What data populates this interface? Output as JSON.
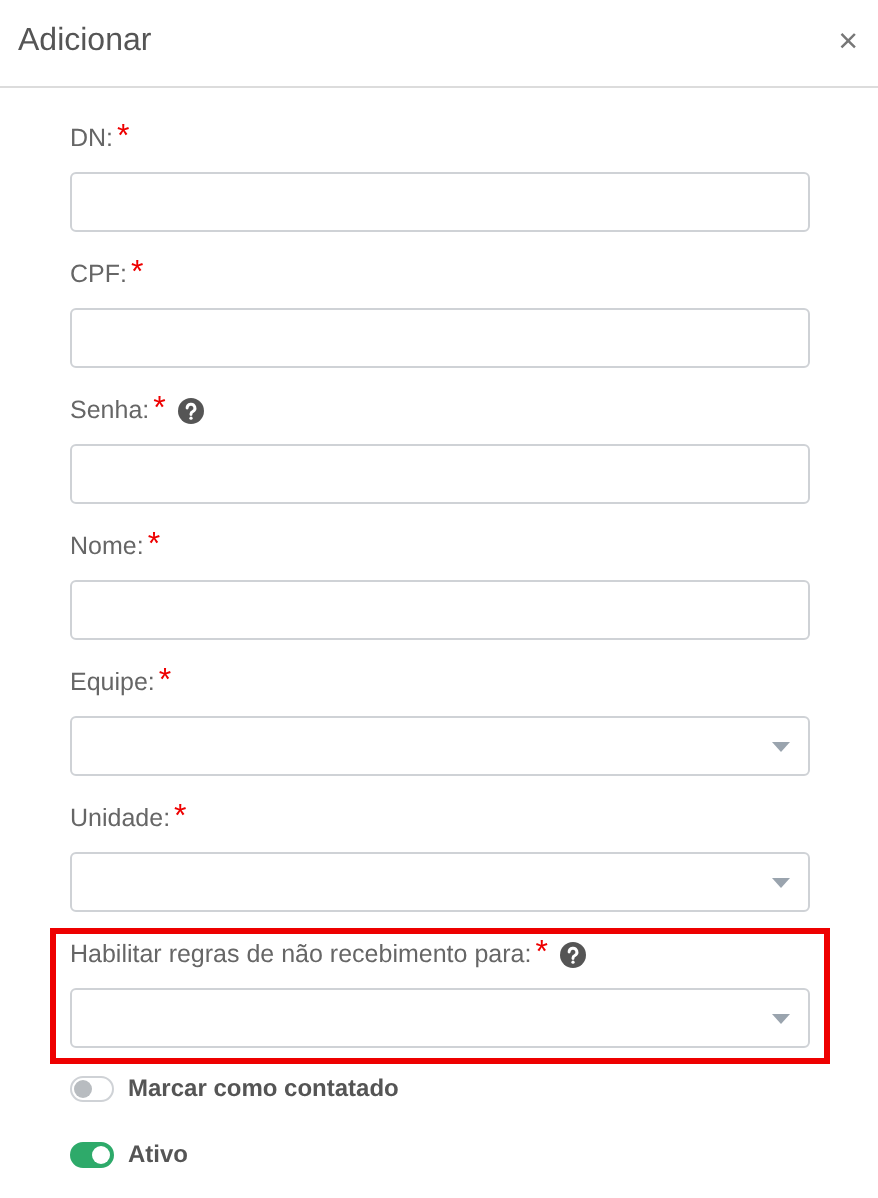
{
  "dialog": {
    "title": "Adicionar",
    "close": "×"
  },
  "fields": [
    {
      "label": "DN:",
      "required_mark": "*",
      "kind": "text",
      "help": false,
      "highlighted": false
    },
    {
      "label": "CPF:",
      "required_mark": "*",
      "kind": "text",
      "help": false,
      "highlighted": false
    },
    {
      "label": "Senha:",
      "required_mark": "*",
      "kind": "text",
      "help": true,
      "highlighted": false
    },
    {
      "label": "Nome:",
      "required_mark": "*",
      "kind": "text",
      "help": false,
      "highlighted": false
    },
    {
      "label": "Equipe:",
      "required_mark": "*",
      "kind": "select",
      "help": false,
      "highlighted": false
    },
    {
      "label": "Unidade:",
      "required_mark": "*",
      "kind": "select",
      "help": false,
      "highlighted": false
    },
    {
      "label": "Habilitar regras de não recebimento para:",
      "required_mark": "*",
      "kind": "select",
      "help": true,
      "highlighted": true
    }
  ],
  "toggles": [
    {
      "label": "Marcar como contatado",
      "on": false
    },
    {
      "label": "Ativo",
      "on": true
    }
  ]
}
